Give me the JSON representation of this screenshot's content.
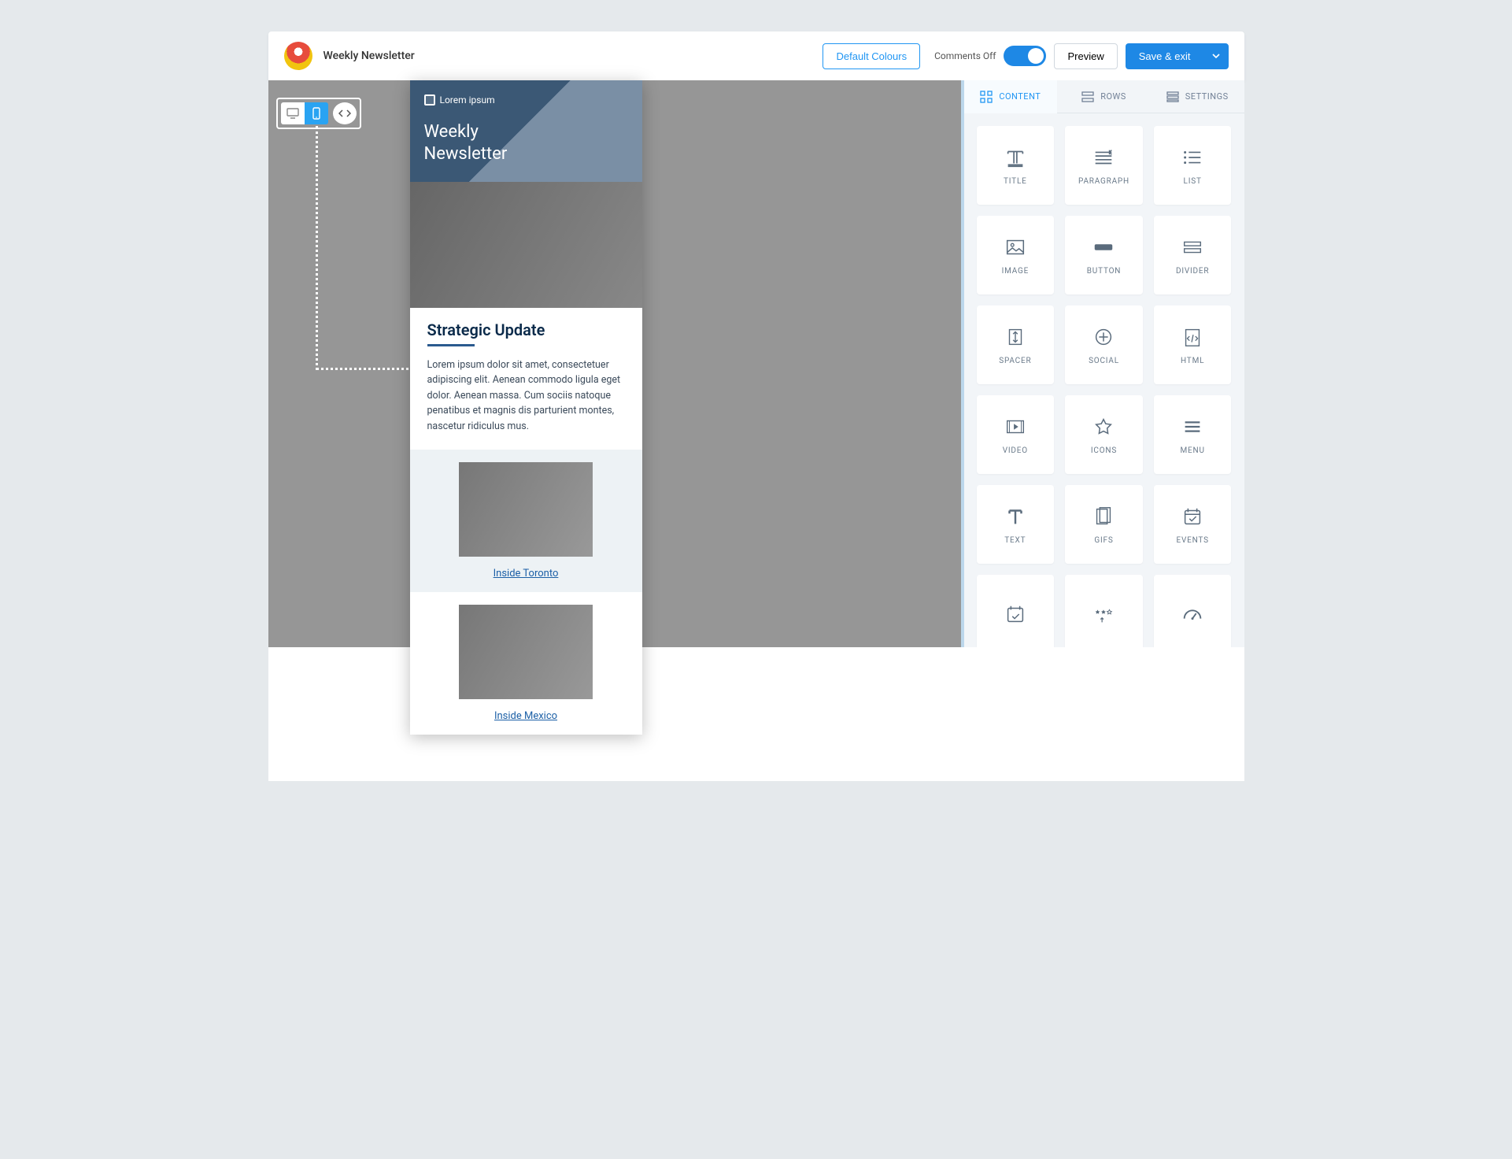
{
  "header": {
    "doc_title": "Weekly Newsletter",
    "default_colours": "Default Colours",
    "comments_label": "Comments Off",
    "preview": "Preview",
    "save_exit": "Save & exit"
  },
  "view_switcher": {
    "desktop_icon": "desktop",
    "mobile_icon": "mobile",
    "preview_icon": "eye"
  },
  "email": {
    "brand": "Lorem ipsum",
    "hero_title_line1": "Weekly",
    "hero_title_line2": "Newsletter",
    "article": {
      "heading": "Strategic Update",
      "body": "Lorem ipsum dolor sit amet, consectetuer adipiscing elit. Aenean commodo ligula eget dolor. Aenean massa. Cum sociis natoque penatibus et magnis dis parturient montes, nascetur ridiculus mus."
    },
    "stories": [
      {
        "link": "Inside Toronto"
      },
      {
        "link": "Inside Mexico"
      }
    ]
  },
  "panel": {
    "tabs": [
      {
        "label": "CONTENT"
      },
      {
        "label": "ROWS"
      },
      {
        "label": "SETTINGS"
      }
    ],
    "tiles": [
      {
        "label": "TITLE",
        "icon": "title"
      },
      {
        "label": "PARAGRAPH",
        "icon": "paragraph"
      },
      {
        "label": "LIST",
        "icon": "list"
      },
      {
        "label": "IMAGE",
        "icon": "image"
      },
      {
        "label": "BUTTON",
        "icon": "button"
      },
      {
        "label": "DIVIDER",
        "icon": "divider"
      },
      {
        "label": "SPACER",
        "icon": "spacer"
      },
      {
        "label": "SOCIAL",
        "icon": "social"
      },
      {
        "label": "HTML",
        "icon": "html"
      },
      {
        "label": "VIDEO",
        "icon": "video"
      },
      {
        "label": "ICONS",
        "icon": "icons"
      },
      {
        "label": "MENU",
        "icon": "menu"
      },
      {
        "label": "TEXT",
        "icon": "text"
      },
      {
        "label": "GIFS",
        "icon": "gifs"
      },
      {
        "label": "EVENTS",
        "icon": "events"
      },
      {
        "label": "",
        "icon": "calendar-check"
      },
      {
        "label": "",
        "icon": "rating"
      },
      {
        "label": "",
        "icon": "gauge"
      }
    ]
  }
}
